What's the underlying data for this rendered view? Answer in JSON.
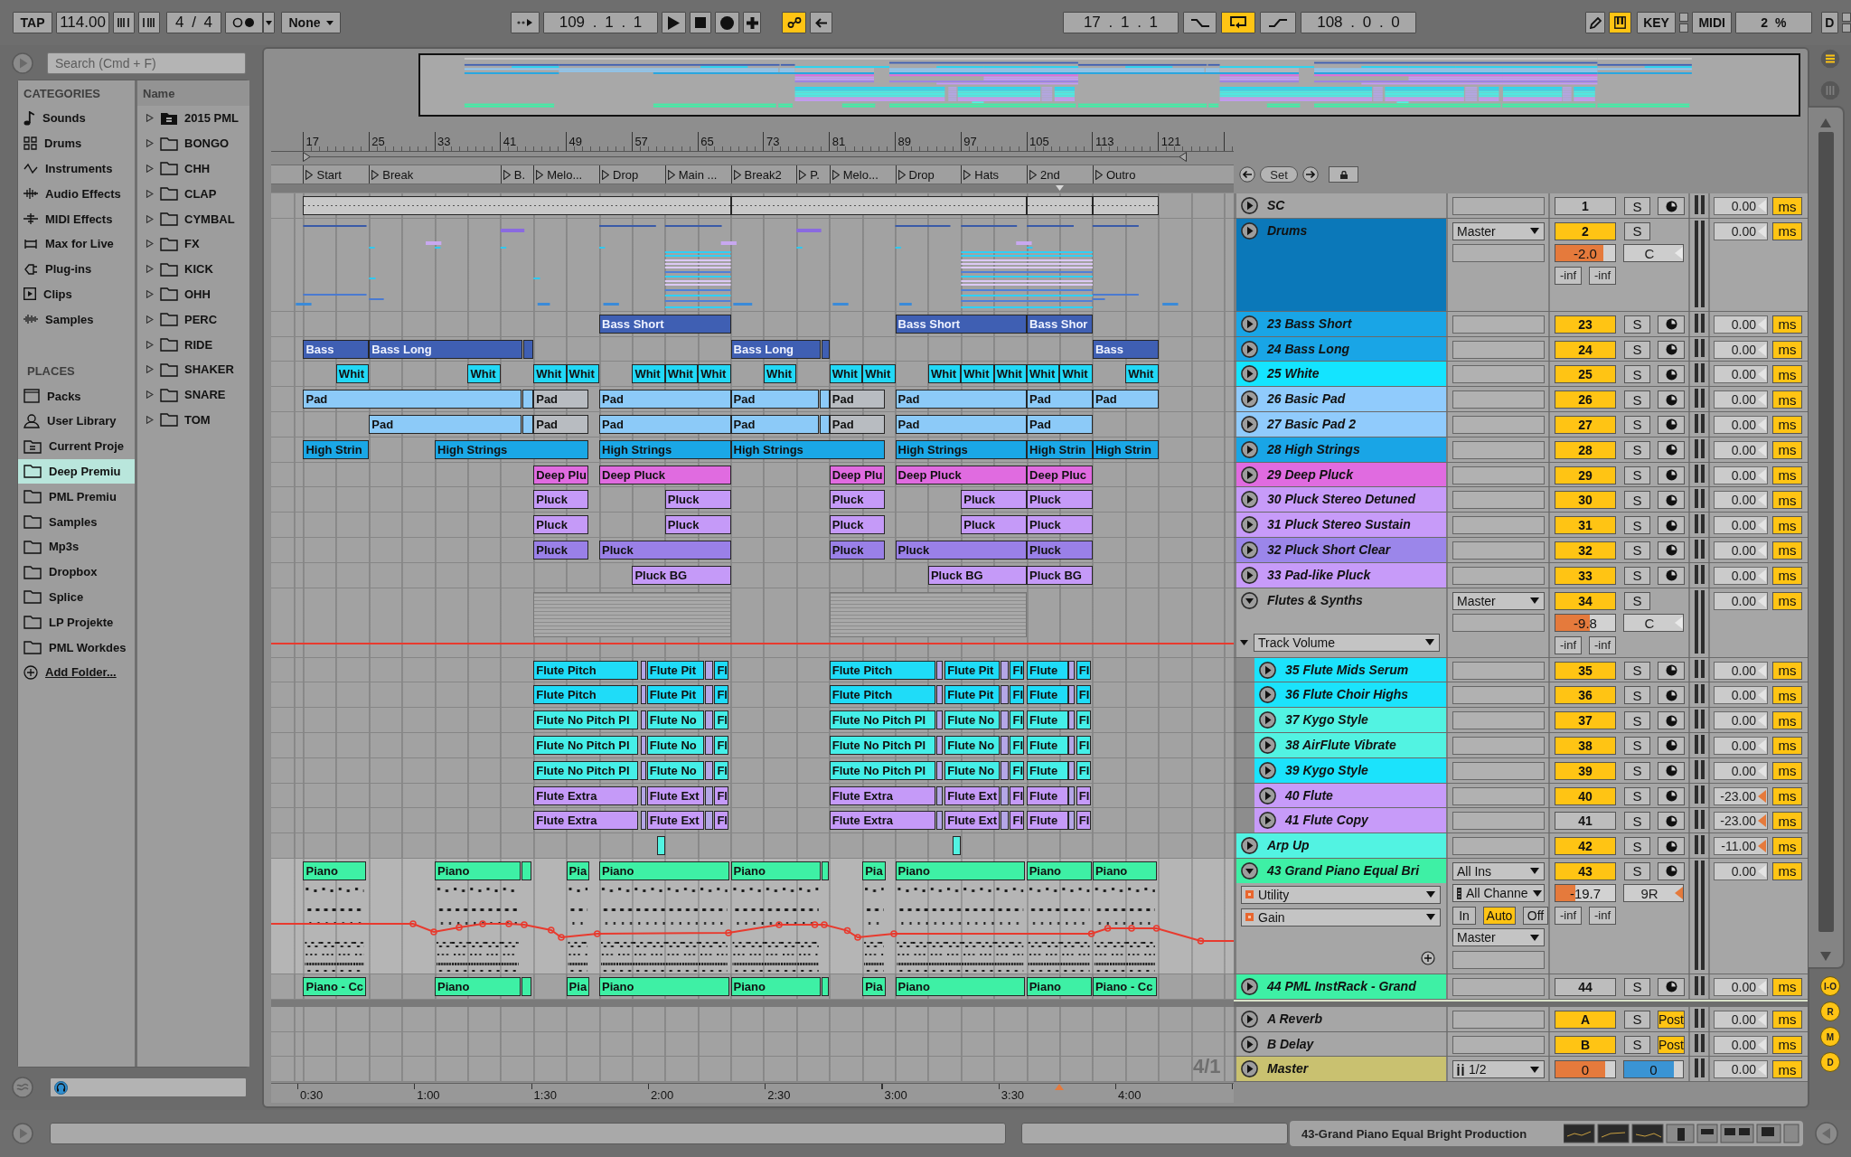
{
  "control_bar": {
    "tap": "TAP",
    "tempo": "114.00",
    "time_signature": "4 / 4",
    "quantization": "None",
    "follow_on": false,
    "position": "109 . 1 . 1",
    "automation_arm_on": true,
    "loop_start": "17 . 1 . 1",
    "punch_in_on": false,
    "loop_on": true,
    "punch_out_on": false,
    "loop_length": "108 . 0 . 0",
    "draw_mode_on": false,
    "computer_keys_on": true,
    "key": "KEY",
    "midi": "MIDI",
    "cpu": "2 %",
    "disk": "D"
  },
  "browser": {
    "search": {
      "placeholder": "Search (Cmd + F)"
    },
    "categories_title": "CATEGORIES",
    "categories": [
      {
        "label": "Sounds",
        "kind": "note",
        "selected": false
      },
      {
        "label": "Drums",
        "kind": "grid",
        "selected": false
      },
      {
        "label": "Instruments",
        "kind": "wave",
        "selected": false
      },
      {
        "label": "Audio Effects",
        "kind": "bars",
        "selected": false
      },
      {
        "label": "MIDI Effects",
        "kind": "sliders",
        "selected": false
      },
      {
        "label": "Max for Live",
        "kind": "frame",
        "selected": false
      },
      {
        "label": "Plug-ins",
        "kind": "plug",
        "selected": false
      },
      {
        "label": "Clips",
        "kind": "clip",
        "selected": false
      },
      {
        "label": "Samples",
        "kind": "waveform",
        "selected": false
      }
    ],
    "places_title": "PLACES",
    "places": [
      {
        "label": "Packs",
        "kind": "box",
        "selected": false
      },
      {
        "label": "User Library",
        "kind": "person",
        "selected": false
      },
      {
        "label": "Current Proje",
        "kind": "project",
        "selected": false
      },
      {
        "label": "Deep Premiu",
        "kind": "folder",
        "selected": true
      },
      {
        "label": "PML Premiu",
        "kind": "folder",
        "selected": false
      },
      {
        "label": "Samples",
        "kind": "folder",
        "selected": false
      },
      {
        "label": "Mp3s",
        "kind": "folder",
        "selected": false
      },
      {
        "label": "Dropbox",
        "kind": "folder",
        "selected": false
      },
      {
        "label": "Splice",
        "kind": "folder",
        "selected": false
      },
      {
        "label": "LP Projekte",
        "kind": "folder",
        "selected": false
      },
      {
        "label": "PML Workdes",
        "kind": "folder",
        "selected": false
      },
      {
        "label": "Add Folder...",
        "kind": "add",
        "selected": false
      }
    ],
    "column_title": "Name",
    "items": [
      {
        "name": "2015 PML",
        "kind": "project",
        "expanded": false
      },
      {
        "name": "BONGO",
        "kind": "folder",
        "expanded": false
      },
      {
        "name": "CHH",
        "kind": "folder",
        "expanded": false
      },
      {
        "name": "CLAP",
        "kind": "folder",
        "expanded": false
      },
      {
        "name": "CYMBAL",
        "kind": "folder",
        "expanded": false
      },
      {
        "name": "FX",
        "kind": "folder",
        "expanded": false
      },
      {
        "name": "KICK",
        "kind": "folder",
        "expanded": false
      },
      {
        "name": "OHH",
        "kind": "folder",
        "expanded": false
      },
      {
        "name": "PERC",
        "kind": "folder",
        "expanded": false
      },
      {
        "name": "RIDE",
        "kind": "folder",
        "expanded": false
      },
      {
        "name": "SHAKER",
        "kind": "folder",
        "expanded": false
      },
      {
        "name": "SNARE",
        "kind": "folder",
        "expanded": false
      },
      {
        "name": "TOM",
        "kind": "folder",
        "expanded": false
      }
    ]
  },
  "arrangement": {
    "bar_numbers": [
      "17",
      "25",
      "33",
      "41",
      "49",
      "57",
      "65",
      "73",
      "81",
      "89",
      "97",
      "105",
      "113",
      "121"
    ],
    "locators": [
      "Start",
      "Break",
      "B.",
      "Melo...",
      "Drop",
      "Main ...",
      "Break2",
      "P.",
      "Melo...",
      "Drop",
      "Hats",
      "2nd",
      "Outro"
    ],
    "set_label": "Set",
    "grid": "4/1",
    "time_labels": [
      "0:30",
      "1:00",
      "1:30",
      "2:00",
      "2:30",
      "3:00",
      "3:30",
      "4:00"
    ]
  },
  "tracks": [
    {
      "name": "SC",
      "kind": "audio",
      "expanded": false,
      "activator": {
        "label": "1",
        "on": false
      },
      "solo": {
        "label": "S",
        "on": false
      },
      "armed": false,
      "delay": {
        "value": "0.00",
        "offset": false,
        "unit": "ms"
      },
      "clips": [
        {
          "color": "#c9c9c9"
        },
        {
          "color": "#c9c9c9"
        },
        {
          "color": "#c9c9c9"
        },
        {
          "color": "#c9c9c9"
        }
      ]
    },
    {
      "name": "Drums",
      "kind": "group",
      "color": "#0b78b9",
      "expanded": false,
      "output": "Master",
      "activator": {
        "label": "2",
        "on": true
      },
      "solo": {
        "label": "S",
        "on": false
      },
      "volume": {
        "value": "-2.0",
        "level": 0.8
      },
      "pan": {
        "value": "C",
        "offset": false
      },
      "peaks": [
        "-inf",
        "-inf"
      ],
      "delay": {
        "value": "0.00",
        "offset": false,
        "unit": "ms"
      }
    },
    {
      "name": "23 Bass Short",
      "kind": "midi",
      "color": "#19a5e6",
      "expanded": false,
      "activator": {
        "label": "23",
        "on": true
      },
      "solo": {
        "label": "S",
        "on": false
      },
      "armed": false,
      "delay": {
        "value": "0.00",
        "offset": false,
        "unit": "ms"
      },
      "clips": [
        {
          "name": "Bass Short",
          "color": "#3f5fb3"
        },
        {
          "name": "Bass Short",
          "color": "#3f5fb3"
        },
        {
          "name": "Bass Shor",
          "color": "#3f5fb3"
        }
      ]
    },
    {
      "name": "24 Bass Long",
      "kind": "midi",
      "color": "#19a5e6",
      "expanded": false,
      "activator": {
        "label": "24",
        "on": true
      },
      "solo": {
        "label": "S",
        "on": false
      },
      "armed": false,
      "delay": {
        "value": "0.00",
        "offset": false,
        "unit": "ms"
      },
      "clips": [
        {
          "name": "Bass",
          "color": "#3f5fb3"
        },
        {
          "name": "Bass Long",
          "color": "#3f5fb3"
        },
        {
          "color": "#3f5fb3"
        },
        {
          "name": "Bass Long",
          "color": "#3f5fb3"
        },
        {
          "color": "#3f5fb3"
        },
        {
          "name": "Bass",
          "color": "#3f5fb3"
        }
      ]
    },
    {
      "name": "25 White",
      "kind": "midi",
      "color": "#14e4ff",
      "expanded": false,
      "activator": {
        "label": "25",
        "on": true
      },
      "solo": {
        "label": "S",
        "on": false
      },
      "armed": false,
      "delay": {
        "value": "0.00",
        "offset": false,
        "unit": "ms"
      },
      "clips": [
        {
          "name": "Whit",
          "color": "#22d8f6"
        },
        {
          "name": "Whit",
          "color": "#22d8f6"
        },
        {
          "name": "Whit",
          "color": "#22d8f6"
        },
        {
          "name": "Whit",
          "color": "#22d8f6"
        },
        {
          "name": "Whit",
          "color": "#22d8f6"
        },
        {
          "name": "Whit",
          "color": "#22d8f6"
        },
        {
          "name": "Whit",
          "color": "#22d8f6"
        },
        {
          "name": "Whit",
          "color": "#22d8f6"
        },
        {
          "name": "Whit",
          "color": "#22d8f6"
        },
        {
          "name": "Whit",
          "color": "#22d8f6"
        },
        {
          "name": "Whit",
          "color": "#22d8f6"
        },
        {
          "name": "Whit",
          "color": "#22d8f6"
        },
        {
          "name": "Whit",
          "color": "#22d8f6"
        },
        {
          "name": "Whit",
          "color": "#22d8f6"
        },
        {
          "name": "Whit",
          "color": "#22d8f6"
        },
        {
          "name": "Whit",
          "color": "#22d8f6"
        }
      ]
    },
    {
      "name": "26 Basic Pad",
      "kind": "midi",
      "color": "#90cbfc",
      "expanded": false,
      "activator": {
        "label": "26",
        "on": true
      },
      "solo": {
        "label": "S",
        "on": false
      },
      "armed": false,
      "delay": {
        "value": "0.00",
        "offset": false,
        "unit": "ms"
      },
      "clips": [
        {
          "name": "Pad",
          "color": "#8ccaf8",
          "active": true
        },
        {
          "color": "#8ccaf8",
          "active": true
        },
        {
          "name": "Pad",
          "active": false
        },
        {
          "name": "Pad",
          "color": "#8ccaf8",
          "active": true
        },
        {
          "name": "Pad",
          "color": "#8ccaf8",
          "active": true
        },
        {
          "color": "#8ccaf8",
          "active": true
        },
        {
          "name": "Pad",
          "active": false
        },
        {
          "name": "Pad",
          "color": "#8ccaf8",
          "active": true
        },
        {
          "name": "Pad",
          "color": "#8ccaf8",
          "active": true
        },
        {
          "name": "Pad",
          "color": "#8ccaf8",
          "active": true
        }
      ]
    },
    {
      "name": "27 Basic Pad 2",
      "kind": "midi",
      "color": "#90cbfc",
      "expanded": false,
      "activator": {
        "label": "27",
        "on": true
      },
      "solo": {
        "label": "S",
        "on": false
      },
      "armed": false,
      "delay": {
        "value": "0.00",
        "offset": false,
        "unit": "ms"
      },
      "clips": [
        {
          "name": "Pad",
          "color": "#8ccaf8",
          "active": true
        },
        {
          "color": "#8ccaf8",
          "active": true
        },
        {
          "name": "Pad",
          "active": false
        },
        {
          "name": "Pad",
          "color": "#8ccaf8",
          "active": true
        },
        {
          "name": "Pad",
          "color": "#8ccaf8",
          "active": true
        },
        {
          "color": "#8ccaf8",
          "active": true
        },
        {
          "name": "Pad",
          "active": false
        },
        {
          "name": "Pad",
          "color": "#8ccaf8",
          "active": true
        },
        {
          "name": "Pad",
          "color": "#8ccaf8",
          "active": true
        }
      ]
    },
    {
      "name": "28 High Strings",
      "kind": "midi",
      "color": "#19a5e6",
      "expanded": false,
      "activator": {
        "label": "28",
        "on": true
      },
      "solo": {
        "label": "S",
        "on": false
      },
      "armed": false,
      "delay": {
        "value": "0.00",
        "offset": false,
        "unit": "ms"
      },
      "clips": [
        {
          "name": "High Strin",
          "color": "#1aa7e6"
        },
        {
          "name": "High Strings",
          "color": "#1aa7e6"
        },
        {
          "name": "High Strings",
          "color": "#1aa7e6"
        },
        {
          "name": "High Strings",
          "color": "#1aa7e6"
        },
        {
          "name": "High Strings",
          "color": "#1aa7e6"
        },
        {
          "name": "High Strin",
          "color": "#1aa7e6"
        },
        {
          "name": "High Strin",
          "color": "#1aa7e6"
        }
      ]
    },
    {
      "name": "29 Deep Pluck",
      "kind": "midi",
      "color": "#e06be0",
      "expanded": false,
      "activator": {
        "label": "29",
        "on": true
      },
      "solo": {
        "label": "S",
        "on": false
      },
      "armed": false,
      "delay": {
        "value": "0.00",
        "offset": false,
        "unit": "ms"
      },
      "clips": [
        {
          "name": "Deep Plu",
          "color": "#e06be0"
        },
        {
          "name": "Deep Pluck",
          "color": "#e06be0"
        },
        {
          "name": "Deep Plu",
          "color": "#e06be0"
        },
        {
          "name": "Deep Pluck",
          "color": "#e06be0"
        },
        {
          "name": "Deep Pluc",
          "color": "#e06be0"
        }
      ]
    },
    {
      "name": "30 Pluck Stereo Detuned",
      "kind": "midi",
      "color": "#c79bf9",
      "expanded": false,
      "activator": {
        "label": "30",
        "on": true
      },
      "solo": {
        "label": "S",
        "on": false
      },
      "armed": false,
      "delay": {
        "value": "0.00",
        "offset": false,
        "unit": "ms"
      },
      "clips": [
        {
          "name": "Pluck",
          "color": "#c59af8"
        },
        {
          "name": "Pluck",
          "color": "#c59af8"
        },
        {
          "name": "Pluck",
          "color": "#c59af8"
        },
        {
          "name": "Pluck",
          "color": "#c59af8"
        },
        {
          "name": "Pluck",
          "color": "#c59af8"
        }
      ]
    },
    {
      "name": "31 Pluck Stereo Sustain",
      "kind": "midi",
      "color": "#c79bf9",
      "expanded": false,
      "activator": {
        "label": "31",
        "on": true
      },
      "solo": {
        "label": "S",
        "on": false
      },
      "armed": false,
      "delay": {
        "value": "0.00",
        "offset": false,
        "unit": "ms"
      },
      "clips": [
        {
          "name": "Pluck",
          "color": "#c59af8"
        },
        {
          "name": "Pluck",
          "color": "#c59af8"
        },
        {
          "name": "Pluck",
          "color": "#c59af8"
        },
        {
          "name": "Pluck",
          "color": "#c59af8"
        },
        {
          "name": "Pluck",
          "color": "#c59af8"
        }
      ]
    },
    {
      "name": "32 Pluck Short Clear",
      "kind": "midi",
      "color": "#9b86ea",
      "expanded": false,
      "activator": {
        "label": "32",
        "on": true
      },
      "solo": {
        "label": "S",
        "on": false
      },
      "armed": false,
      "delay": {
        "value": "0.00",
        "offset": false,
        "unit": "ms"
      },
      "clips": [
        {
          "name": "Pluck",
          "color": "#9a80e8"
        },
        {
          "name": "Pluck",
          "color": "#9a80e8"
        },
        {
          "name": "Pluck",
          "color": "#9a80e8"
        },
        {
          "name": "Pluck",
          "color": "#9a80e8"
        },
        {
          "name": "Pluck",
          "color": "#9a80e8"
        }
      ]
    },
    {
      "name": "33 Pad-like Pluck",
      "kind": "midi",
      "color": "#c79bf9",
      "expanded": false,
      "activator": {
        "label": "33",
        "on": true
      },
      "solo": {
        "label": "S",
        "on": false
      },
      "armed": false,
      "delay": {
        "value": "0.00",
        "offset": false,
        "unit": "ms"
      },
      "clips": [
        {
          "name": "Pluck BG",
          "color": "#c59af8"
        },
        {
          "name": "Pluck BG",
          "color": "#c59af8"
        },
        {
          "name": "Pluck BG",
          "color": "#c59af8"
        }
      ]
    },
    {
      "name": "Flutes & Synths",
      "kind": "group",
      "expanded": true,
      "automation": {
        "parameter": "Track Volume"
      },
      "output": "Master",
      "activator": {
        "label": "34",
        "on": true
      },
      "solo": {
        "label": "S",
        "on": false
      },
      "volume": {
        "value": "-9.8",
        "level": 0.57
      },
      "pan": {
        "value": "C",
        "offset": false
      },
      "peaks": [
        "-inf",
        "-inf"
      ],
      "delay": {
        "value": "0.00",
        "offset": false,
        "unit": "ms"
      },
      "children": [
        {
          "name": "35 Flute Mids Serum",
          "kind": "midi",
          "color": "#1be3fc",
          "expanded": false,
          "activator": {
            "label": "35",
            "on": true
          },
          "solo": {
            "label": "S",
            "on": false
          },
          "armed": false,
          "delay": {
            "value": "0.00",
            "offset": false,
            "unit": "ms"
          },
          "clips": [
            {
              "name": "Flute Pitch",
              "color": "#1fdcf8"
            },
            {
              "color": "#b4a6e6"
            },
            {
              "name": "Flute Pit",
              "color": "#1fdcf8"
            },
            {
              "color": "#b4a6e6"
            },
            {
              "name": "Fl",
              "color": "#1fdcf8"
            },
            {
              "name": "Flute Pitch",
              "color": "#1fdcf8"
            },
            {
              "color": "#b4a6e6"
            },
            {
              "name": "Flute Pit",
              "color": "#1fdcf8"
            },
            {
              "color": "#b4a6e6"
            },
            {
              "name": "Fl",
              "color": "#1fdcf8"
            },
            {
              "name": "Flute",
              "color": "#1fdcf8"
            },
            {
              "color": "#b4a6e6"
            },
            {
              "name": "Fl",
              "color": "#1fdcf8"
            }
          ]
        },
        {
          "name": "36 Flute Choir Highs",
          "kind": "midi",
          "color": "#1be3fc",
          "expanded": false,
          "activator": {
            "label": "36",
            "on": true
          },
          "solo": {
            "label": "S",
            "on": false
          },
          "armed": false,
          "delay": {
            "value": "0.00",
            "offset": false,
            "unit": "ms"
          },
          "clips": [
            {
              "name": "Flute Pitch",
              "color": "#1fdcf8"
            },
            {
              "color": "#b4a6e6"
            },
            {
              "name": "Flute Pit",
              "color": "#1fdcf8"
            },
            {
              "color": "#b4a6e6"
            },
            {
              "name": "Fl",
              "color": "#1fdcf8"
            },
            {
              "name": "Flute Pitch",
              "color": "#1fdcf8"
            },
            {
              "color": "#b4a6e6"
            },
            {
              "name": "Flute Pit",
              "color": "#1fdcf8"
            },
            {
              "color": "#b4a6e6"
            },
            {
              "name": "Fl",
              "color": "#1fdcf8"
            },
            {
              "name": "Flute",
              "color": "#1fdcf8"
            },
            {
              "color": "#b4a6e6"
            },
            {
              "name": "Fl",
              "color": "#1fdcf8"
            }
          ]
        },
        {
          "name": "37 Kygo Style",
          "kind": "midi",
          "color": "#52f3e2",
          "expanded": false,
          "activator": {
            "label": "37",
            "on": true
          },
          "solo": {
            "label": "S",
            "on": false
          },
          "armed": false,
          "delay": {
            "value": "0.00",
            "offset": false,
            "unit": "ms"
          },
          "clips": [
            {
              "name": "Flute No Pitch Pl",
              "color": "#45efe8"
            },
            {
              "color": "#b4a6e6"
            },
            {
              "name": "Flute No",
              "color": "#45efe8"
            },
            {
              "color": "#b4a6e6"
            },
            {
              "name": "Fl",
              "color": "#45efe8"
            },
            {
              "name": "Flute No Pitch Pl",
              "color": "#45efe8"
            },
            {
              "color": "#b4a6e6"
            },
            {
              "name": "Flute No",
              "color": "#45efe8"
            },
            {
              "color": "#b4a6e6"
            },
            {
              "name": "Fl",
              "color": "#45efe8"
            },
            {
              "name": "Flute",
              "color": "#45efe8"
            },
            {
              "color": "#b4a6e6"
            },
            {
              "name": "Fl",
              "color": "#45efe8"
            }
          ]
        },
        {
          "name": "38 AirFlute Vibrate",
          "kind": "midi",
          "color": "#52f3e2",
          "expanded": false,
          "activator": {
            "label": "38",
            "on": true
          },
          "solo": {
            "label": "S",
            "on": false
          },
          "armed": false,
          "delay": {
            "value": "0.00",
            "offset": false,
            "unit": "ms"
          },
          "clips": [
            {
              "name": "Flute No Pitch Pl",
              "color": "#45efe8"
            },
            {
              "color": "#b4a6e6"
            },
            {
              "name": "Flute No",
              "color": "#45efe8"
            },
            {
              "color": "#b4a6e6"
            },
            {
              "name": "Fl",
              "color": "#45efe8"
            },
            {
              "name": "Flute No Pitch Pl",
              "color": "#45efe8"
            },
            {
              "color": "#b4a6e6"
            },
            {
              "name": "Flute No",
              "color": "#45efe8"
            },
            {
              "color": "#b4a6e6"
            },
            {
              "name": "Fl",
              "color": "#45efe8"
            },
            {
              "name": "Flute",
              "color": "#45efe8"
            },
            {
              "color": "#b4a6e6"
            },
            {
              "name": "Fl",
              "color": "#45efe8"
            }
          ]
        },
        {
          "name": "39 Kygo Style",
          "kind": "midi",
          "color": "#1be3fc",
          "expanded": false,
          "activator": {
            "label": "39",
            "on": true
          },
          "solo": {
            "label": "S",
            "on": false
          },
          "armed": false,
          "delay": {
            "value": "0.00",
            "offset": false,
            "unit": "ms"
          },
          "clips": [
            {
              "name": "Flute No Pitch Pl",
              "color": "#45efe8"
            },
            {
              "color": "#b4a6e6"
            },
            {
              "name": "Flute No",
              "color": "#45efe8"
            },
            {
              "color": "#b4a6e6"
            },
            {
              "name": "Fl",
              "color": "#45efe8"
            },
            {
              "name": "Flute No Pitch Pl",
              "color": "#45efe8"
            },
            {
              "color": "#b4a6e6"
            },
            {
              "name": "Flute No",
              "color": "#45efe8"
            },
            {
              "color": "#b4a6e6"
            },
            {
              "name": "Fl",
              "color": "#45efe8"
            },
            {
              "name": "Flute",
              "color": "#45efe8"
            },
            {
              "color": "#b4a6e6"
            },
            {
              "name": "Fl",
              "color": "#45efe8"
            }
          ]
        },
        {
          "name": "40 Flute",
          "kind": "midi",
          "color": "#c79bf9",
          "expanded": false,
          "activator": {
            "label": "40",
            "on": true
          },
          "solo": {
            "label": "S",
            "on": false
          },
          "armed": false,
          "delay": {
            "value": "-23.00",
            "offset": true,
            "unit": "ms"
          },
          "clips": [
            {
              "name": "Flute Extra",
              "color": "#c59af8"
            },
            {
              "color": "#b4a6e6"
            },
            {
              "name": "Flute Ext",
              "color": "#c59af8"
            },
            {
              "color": "#b4a6e6"
            },
            {
              "name": "Fl",
              "color": "#c59af8"
            },
            {
              "name": "Flute Extra",
              "color": "#c59af8"
            },
            {
              "color": "#b4a6e6"
            },
            {
              "name": "Flute Ext",
              "color": "#c59af8"
            },
            {
              "color": "#b4a6e6"
            },
            {
              "name": "Fl",
              "color": "#c59af8"
            },
            {
              "name": "Flute",
              "color": "#c59af8"
            },
            {
              "color": "#b4a6e6"
            },
            {
              "name": "Fl",
              "color": "#c59af8"
            }
          ]
        },
        {
          "name": "41 Flute Copy",
          "kind": "midi",
          "color": "#c79bf9",
          "expanded": false,
          "activator": {
            "label": "41",
            "on": false
          },
          "solo": {
            "label": "S",
            "on": false
          },
          "armed": false,
          "delay": {
            "value": "-23.00",
            "offset": true,
            "unit": "ms"
          },
          "clips": [
            {
              "name": "Flute Extra",
              "color": "#c59af8"
            },
            {
              "color": "#b4a6e6"
            },
            {
              "name": "Flute Ext",
              "color": "#c59af8"
            },
            {
              "color": "#b4a6e6"
            },
            {
              "name": "Fl",
              "color": "#c59af8"
            },
            {
              "name": "Flute Extra",
              "color": "#c59af8"
            },
            {
              "color": "#b4a6e6"
            },
            {
              "name": "Flute Ext",
              "color": "#c59af8"
            },
            {
              "color": "#b4a6e6"
            },
            {
              "name": "Fl",
              "color": "#c59af8"
            },
            {
              "name": "Flute",
              "color": "#c59af8"
            },
            {
              "color": "#b4a6e6"
            },
            {
              "name": "Fl",
              "color": "#c59af8"
            }
          ]
        }
      ]
    },
    {
      "name": "Arp Up",
      "kind": "midi",
      "color": "#52f3e2",
      "expanded": false,
      "activator": {
        "label": "42",
        "on": true
      },
      "solo": {
        "label": "S",
        "on": false
      },
      "armed": false,
      "delay": {
        "value": "-11.00",
        "offset": true,
        "unit": "ms"
      },
      "clips": [
        {
          "color": "#52f3e2"
        },
        {
          "color": "#52f3e2"
        }
      ]
    },
    {
      "name": "43 Grand Piano Equal Bri",
      "kind": "midi",
      "color": "#3ef0a5",
      "expanded": true,
      "automation": {
        "device": "Utility",
        "parameter": "Gain"
      },
      "input": "All Ins",
      "input_channel": "All Channe",
      "monitor": [
        {
          "label": "In",
          "selected": false
        },
        {
          "label": "Auto",
          "selected": true
        },
        {
          "label": "Off",
          "selected": false
        }
      ],
      "output": "Master",
      "activator": {
        "label": "43",
        "on": true
      },
      "solo": {
        "label": "S",
        "on": false
      },
      "armed": false,
      "volume": {
        "value": "-19.7",
        "level": 0.34
      },
      "pan": {
        "value": "9R",
        "offset": true
      },
      "peaks": [
        "-inf",
        "-inf"
      ],
      "delay": {
        "value": "0.00",
        "offset": false,
        "unit": "ms"
      },
      "clips": [
        {
          "name": "Piano",
          "color": "#3ef0a5"
        },
        {
          "name": "Piano",
          "color": "#3ef0a5"
        },
        {
          "color": "#3ef0a5"
        },
        {
          "name": "Pia",
          "color": "#3ef0a5"
        },
        {
          "name": "Piano",
          "color": "#3ef0a5"
        },
        {
          "name": "Piano",
          "color": "#3ef0a5"
        },
        {
          "color": "#3ef0a5"
        },
        {
          "name": "Pia",
          "color": "#3ef0a5"
        },
        {
          "name": "Piano",
          "color": "#3ef0a5"
        },
        {
          "name": "Piano",
          "color": "#3ef0a5"
        },
        {
          "name": "Piano",
          "color": "#3ef0a5"
        }
      ]
    },
    {
      "name": "44 PML InstRack - Grand",
      "kind": "midi",
      "color": "#3ef0a5",
      "expanded": false,
      "activator": {
        "label": "44",
        "on": false
      },
      "solo": {
        "label": "S",
        "on": false
      },
      "armed": false,
      "delay": {
        "value": "0.00",
        "offset": false,
        "unit": "ms"
      },
      "clips": [
        {
          "name": "Piano - Cc",
          "color": "#3ef0a5"
        },
        {
          "name": "Piano",
          "color": "#3ef0a5"
        },
        {
          "color": "#3ef0a5"
        },
        {
          "name": "Pia",
          "color": "#3ef0a5"
        },
        {
          "name": "Piano",
          "color": "#3ef0a5"
        },
        {
          "name": "Piano",
          "color": "#3ef0a5"
        },
        {
          "color": "#3ef0a5"
        },
        {
          "name": "Pia",
          "color": "#3ef0a5"
        },
        {
          "name": "Piano",
          "color": "#3ef0a5"
        },
        {
          "name": "Piano",
          "color": "#3ef0a5"
        },
        {
          "name": "Piano - Cc",
          "color": "#3ef0a5"
        }
      ]
    }
  ],
  "return_tracks": [
    {
      "name": "A Reverb",
      "kind": "return",
      "expanded": false,
      "activator": {
        "label": "A",
        "on": true
      },
      "solo": {
        "label": "S",
        "on": false
      },
      "post": {
        "label": "Post",
        "on": true
      },
      "delay": {
        "value": "0.00",
        "offset": false,
        "unit": "ms"
      }
    },
    {
      "name": "B Delay",
      "kind": "return",
      "expanded": false,
      "activator": {
        "label": "B",
        "on": true
      },
      "solo": {
        "label": "S",
        "on": false
      },
      "post": {
        "label": "Post",
        "on": true
      },
      "delay": {
        "value": "0.00",
        "offset": false,
        "unit": "ms"
      }
    }
  ],
  "master_track": {
    "name": "Master",
    "kind": "master",
    "color": "#c9c170",
    "expanded": false,
    "output": "1/2",
    "volume": {
      "value": "0",
      "level": 0.83
    },
    "cue": {
      "value": "0",
      "level": 0.84
    },
    "delay": {
      "value": "0.00",
      "offset": false,
      "unit": "ms"
    }
  },
  "view_toggles": [
    {
      "label": "I-O",
      "on": true
    },
    {
      "label": "R",
      "on": true
    },
    {
      "label": "M",
      "on": true
    },
    {
      "label": "D",
      "on": true
    }
  ],
  "status_bar": {
    "text": "43-Grand Piano Equal Bright Production"
  }
}
